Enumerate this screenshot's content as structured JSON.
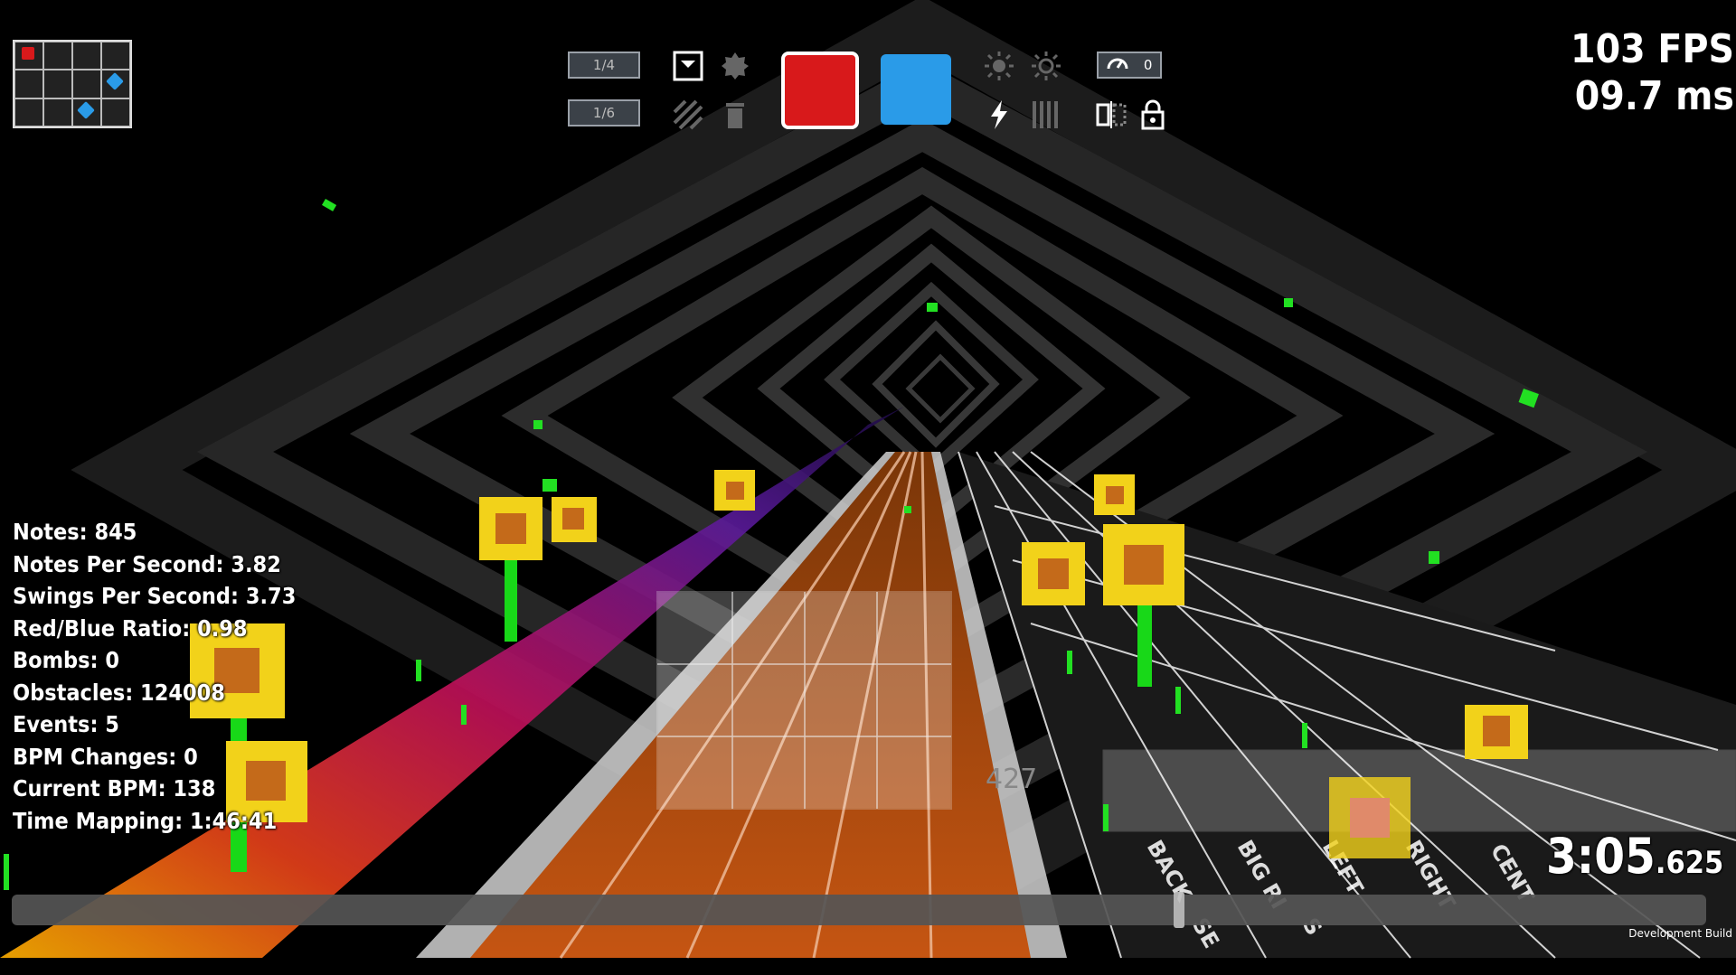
{
  "toolbar": {
    "precision_primary": "1/4",
    "precision_secondary": "1/6",
    "speed_value": "0",
    "colors": {
      "left_note": "#d8191b",
      "right_note": "#2a9be8"
    },
    "icons": [
      "note-icon",
      "bomb-icon",
      "obstacle-icon",
      "delete-icon",
      "light-on-icon",
      "light-off-icon",
      "bolt-icon",
      "bars-icon",
      "speedometer-icon",
      "mirror-icon",
      "lock-icon"
    ]
  },
  "performance": {
    "fps": "103 FPS",
    "frame_time": "09.7 ms"
  },
  "stats": {
    "notes": "Notes: 845",
    "nps": "Notes Per Second: 3.82",
    "sps": "Swings Per Second: 3.73",
    "ratio": "Red/Blue Ratio: 0.98",
    "bombs": "Bombs: 0",
    "obstacles": "Obstacles: 124008",
    "events": "Events: 5",
    "bpm_changes": "BPM Changes: 0",
    "current_bpm": "Current BPM: 138",
    "time_mapping": "Time Mapping: 1:46:41"
  },
  "timeline": {
    "progress": 0.689
  },
  "time": {
    "main": "3:05",
    "fraction": ".625"
  },
  "track": {
    "beat_marker": "427",
    "lane_labels": [
      "BACK",
      "BIG RI",
      "LEFT",
      "RIGHT",
      "CENT"
    ],
    "lower_labels": [
      "SE",
      "S"
    ]
  },
  "build_label": "Development Build",
  "minimap": {
    "notes": [
      {
        "row": 0,
        "col": 0,
        "color": "#d8191b"
      },
      {
        "row": 1,
        "col": 3,
        "color": "#2a9be8"
      },
      {
        "row": 2,
        "col": 2,
        "color": "#2a9be8"
      }
    ]
  }
}
